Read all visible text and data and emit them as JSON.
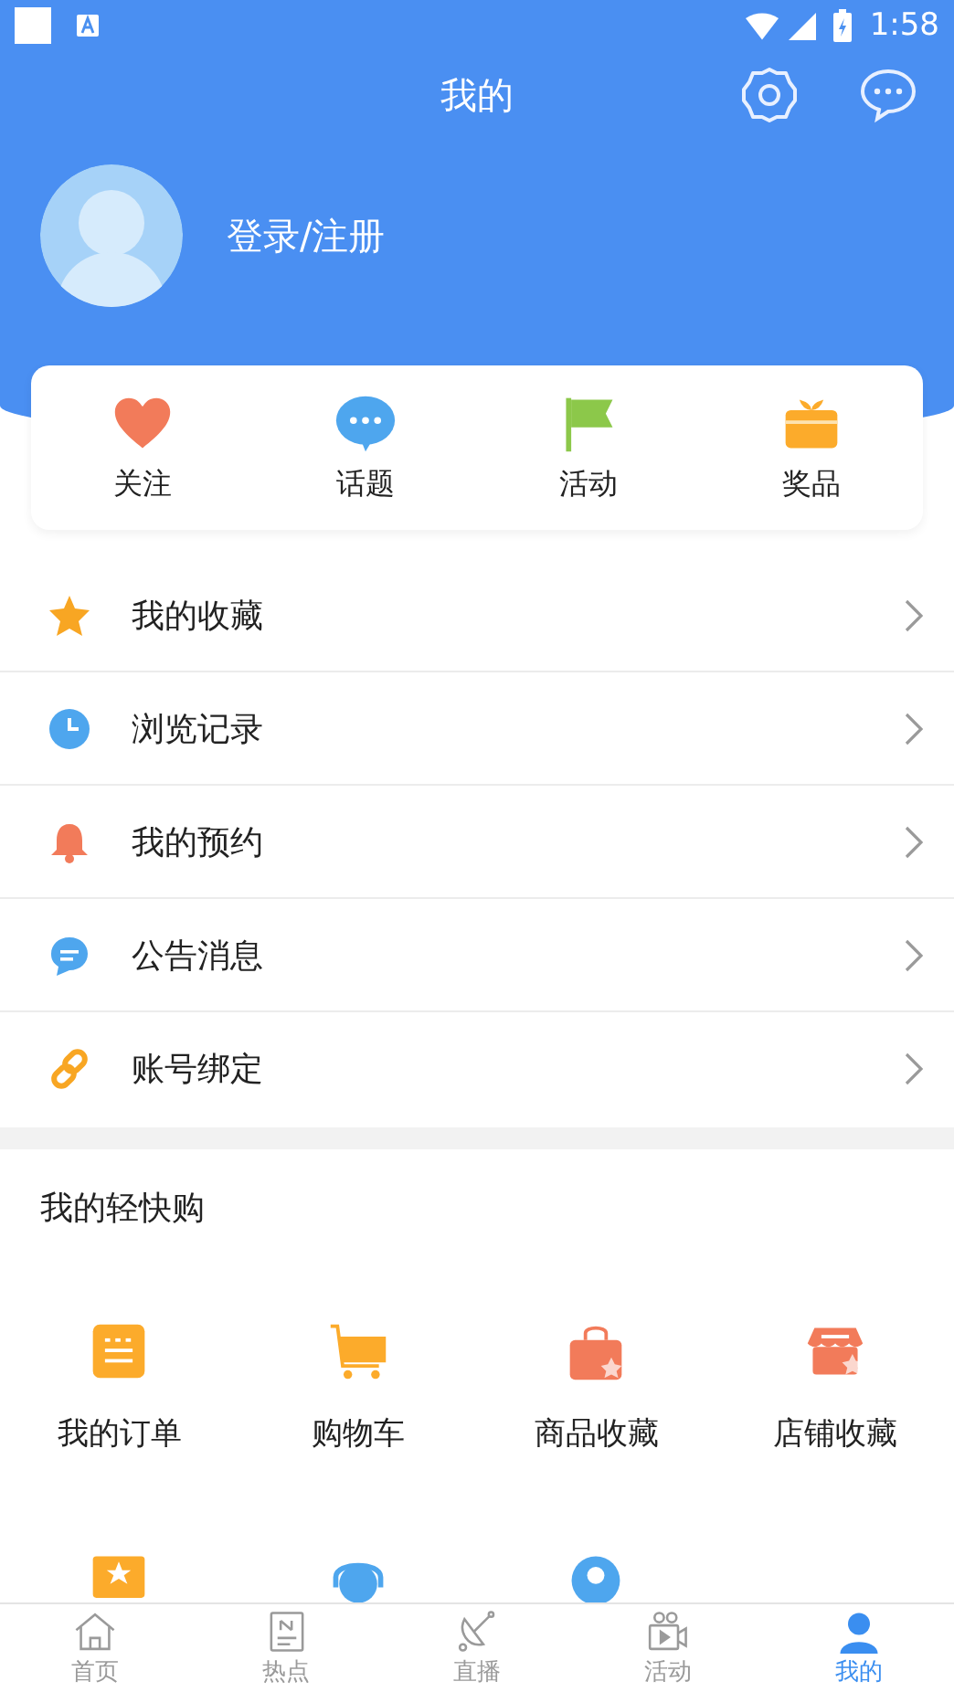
{
  "status_bar": {
    "time": "1:58"
  },
  "header": {
    "title": "我的"
  },
  "profile": {
    "login_label": "登录/注册"
  },
  "quick_actions": [
    {
      "kind": "heart",
      "label": "关注"
    },
    {
      "kind": "chat",
      "label": "话题"
    },
    {
      "kind": "flag",
      "label": "活动"
    },
    {
      "kind": "gift",
      "label": "奖品"
    }
  ],
  "menu": [
    {
      "kind": "star",
      "label": "我的收藏"
    },
    {
      "kind": "clock",
      "label": "浏览记录"
    },
    {
      "kind": "bell",
      "label": "我的预约"
    },
    {
      "kind": "message",
      "label": "公告消息"
    },
    {
      "kind": "link",
      "label": "账号绑定"
    }
  ],
  "shop": {
    "title": "我的轻快购",
    "items": [
      {
        "kind": "order",
        "label": "我的订单"
      },
      {
        "kind": "cart",
        "label": "购物车"
      },
      {
        "kind": "bag",
        "label": "商品收藏"
      },
      {
        "kind": "store",
        "label": "店铺收藏"
      }
    ],
    "more_items": [
      {
        "kind": "ticket"
      },
      {
        "kind": "headset"
      },
      {
        "kind": "pin"
      }
    ]
  },
  "tab_bar": [
    {
      "kind": "home",
      "label": "首页",
      "selected": false
    },
    {
      "kind": "news",
      "label": "热点",
      "selected": false
    },
    {
      "kind": "dish",
      "label": "直播",
      "selected": false
    },
    {
      "kind": "video",
      "label": "活动",
      "selected": false
    },
    {
      "kind": "user",
      "label": "我的",
      "selected": true
    }
  ]
}
